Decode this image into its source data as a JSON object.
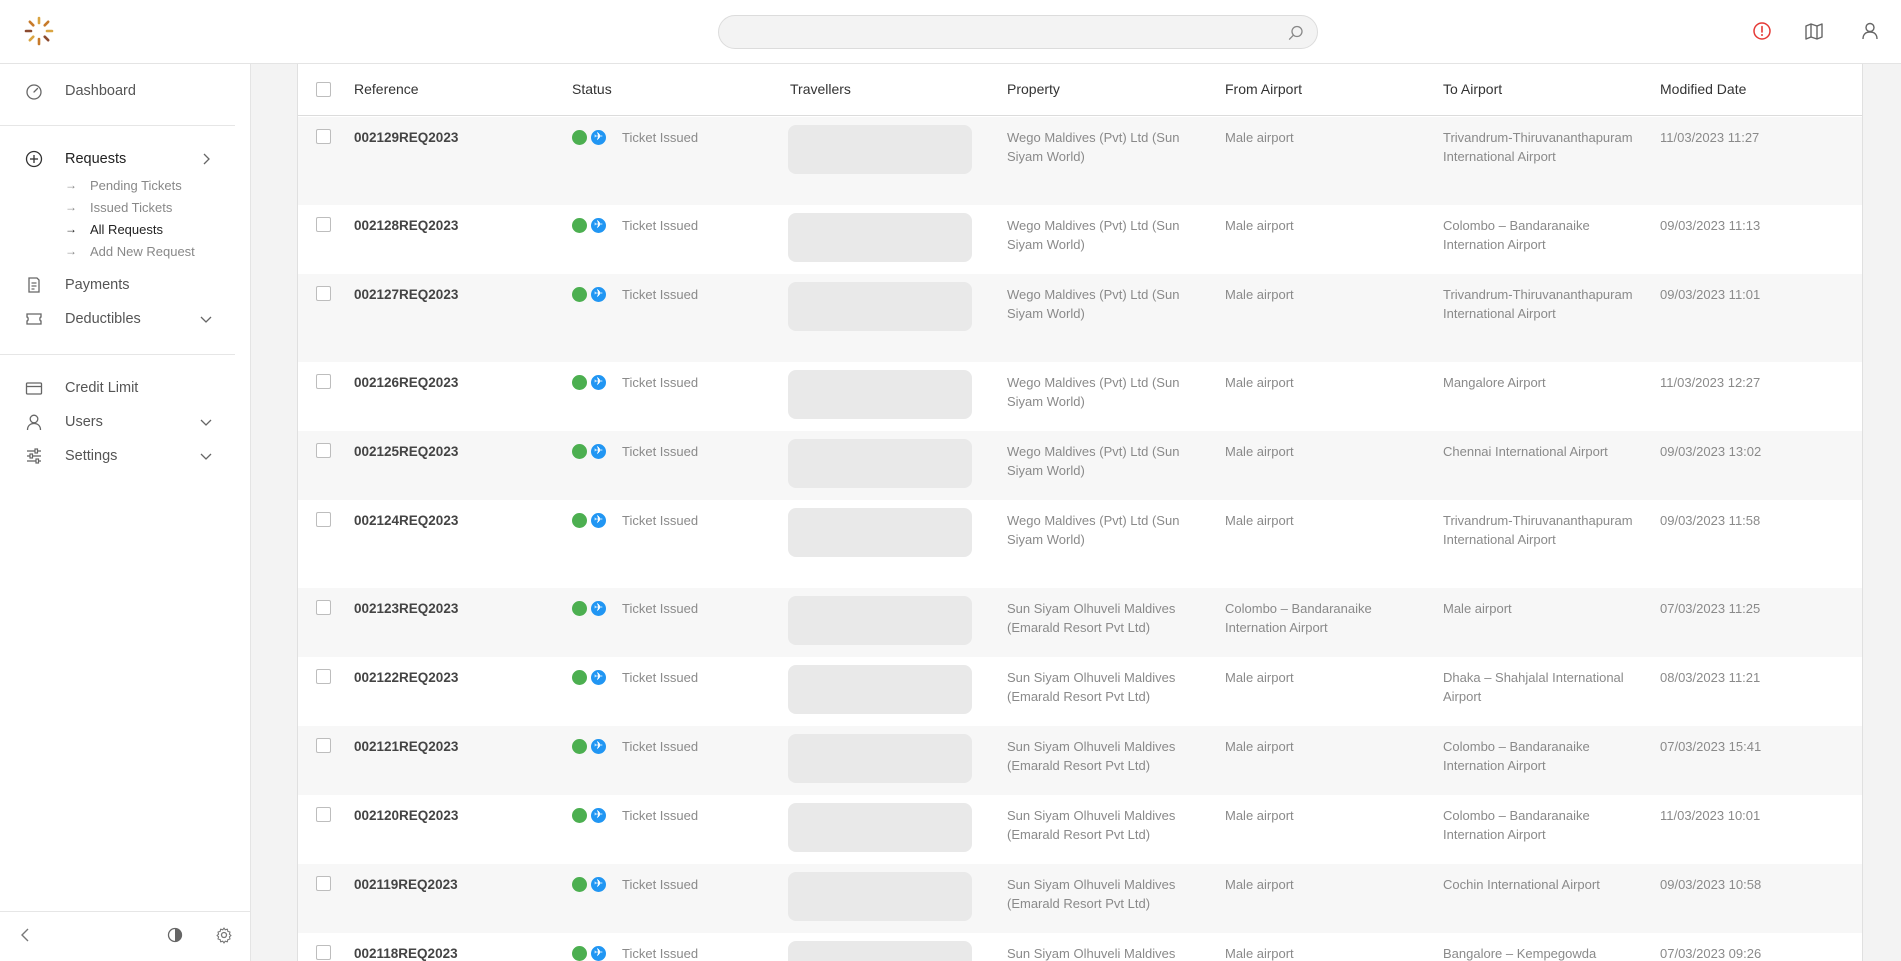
{
  "search": {
    "placeholder": ""
  },
  "sidebar": {
    "dashboard": "Dashboard",
    "requests": "Requests",
    "requests_sub": [
      "Pending Tickets",
      "Issued Tickets",
      "All Requests",
      "Add New Request"
    ],
    "payments": "Payments",
    "deductibles": "Deductibles",
    "credit_limit": "Credit Limit",
    "users": "Users",
    "settings": "Settings"
  },
  "table": {
    "headers": [
      "Reference",
      "Status",
      "Travellers",
      "Property",
      "From Airport",
      "To Airport",
      "Modified Date"
    ],
    "rows": [
      {
        "ref": "002129REQ2023",
        "status": "Ticket Issued",
        "property": "Wego Maldives (Pvt) Ltd (Sun Siyam World)",
        "from": "Male airport",
        "to": "Trivandrum-Thiruvananthapuram International Airport",
        "date": "11/03/2023 11:27"
      },
      {
        "ref": "002128REQ2023",
        "status": "Ticket Issued",
        "property": "Wego Maldives (Pvt) Ltd (Sun Siyam World)",
        "from": "Male airport",
        "to": "Colombo – Bandaranaike Internation Airport",
        "date": "09/03/2023 11:13"
      },
      {
        "ref": "002127REQ2023",
        "status": "Ticket Issued",
        "property": "Wego Maldives (Pvt) Ltd (Sun Siyam World)",
        "from": "Male airport",
        "to": "Trivandrum-Thiruvananthapuram International Airport",
        "date": "09/03/2023 11:01"
      },
      {
        "ref": "002126REQ2023",
        "status": "Ticket Issued",
        "property": "Wego Maldives (Pvt) Ltd (Sun Siyam World)",
        "from": "Male airport",
        "to": "Mangalore Airport",
        "date": "11/03/2023 12:27"
      },
      {
        "ref": "002125REQ2023",
        "status": "Ticket Issued",
        "property": "Wego Maldives (Pvt) Ltd (Sun Siyam World)",
        "from": "Male airport",
        "to": "Chennai International Airport",
        "date": "09/03/2023 13:02"
      },
      {
        "ref": "002124REQ2023",
        "status": "Ticket Issued",
        "property": "Wego Maldives (Pvt) Ltd (Sun Siyam World)",
        "from": "Male airport",
        "to": "Trivandrum-Thiruvananthapuram International Airport",
        "date": "09/03/2023 11:58"
      },
      {
        "ref": "002123REQ2023",
        "status": "Ticket Issued",
        "property": "Sun Siyam Olhuveli Maldives (Emarald Resort Pvt Ltd)",
        "from": "Colombo – Bandaranaike Internation Airport",
        "to": "Male airport",
        "date": "07/03/2023 11:25"
      },
      {
        "ref": "002122REQ2023",
        "status": "Ticket Issued",
        "property": "Sun Siyam Olhuveli Maldives (Emarald Resort Pvt Ltd)",
        "from": "Male airport",
        "to": "Dhaka – Shahjalal International Airport",
        "date": "08/03/2023 11:21"
      },
      {
        "ref": "002121REQ2023",
        "status": "Ticket Issued",
        "property": "Sun Siyam Olhuveli Maldives (Emarald Resort Pvt Ltd)",
        "from": "Male airport",
        "to": "Colombo – Bandaranaike Internation Airport",
        "date": "07/03/2023 15:41"
      },
      {
        "ref": "002120REQ2023",
        "status": "Ticket Issued",
        "property": "Sun Siyam Olhuveli Maldives (Emarald Resort Pvt Ltd)",
        "from": "Male airport",
        "to": "Colombo – Bandaranaike Internation Airport",
        "date": "11/03/2023 10:01"
      },
      {
        "ref": "002119REQ2023",
        "status": "Ticket Issued",
        "property": "Sun Siyam Olhuveli Maldives (Emarald Resort Pvt Ltd)",
        "from": "Male airport",
        "to": "Cochin International Airport",
        "date": "09/03/2023 10:58"
      },
      {
        "ref": "002118REQ2023",
        "status": "Ticket Issued",
        "property": "Sun Siyam Olhuveli Maldives",
        "from": "Male airport",
        "to": "Bangalore – Kempegowda",
        "date": "07/03/2023 09:26"
      }
    ]
  }
}
